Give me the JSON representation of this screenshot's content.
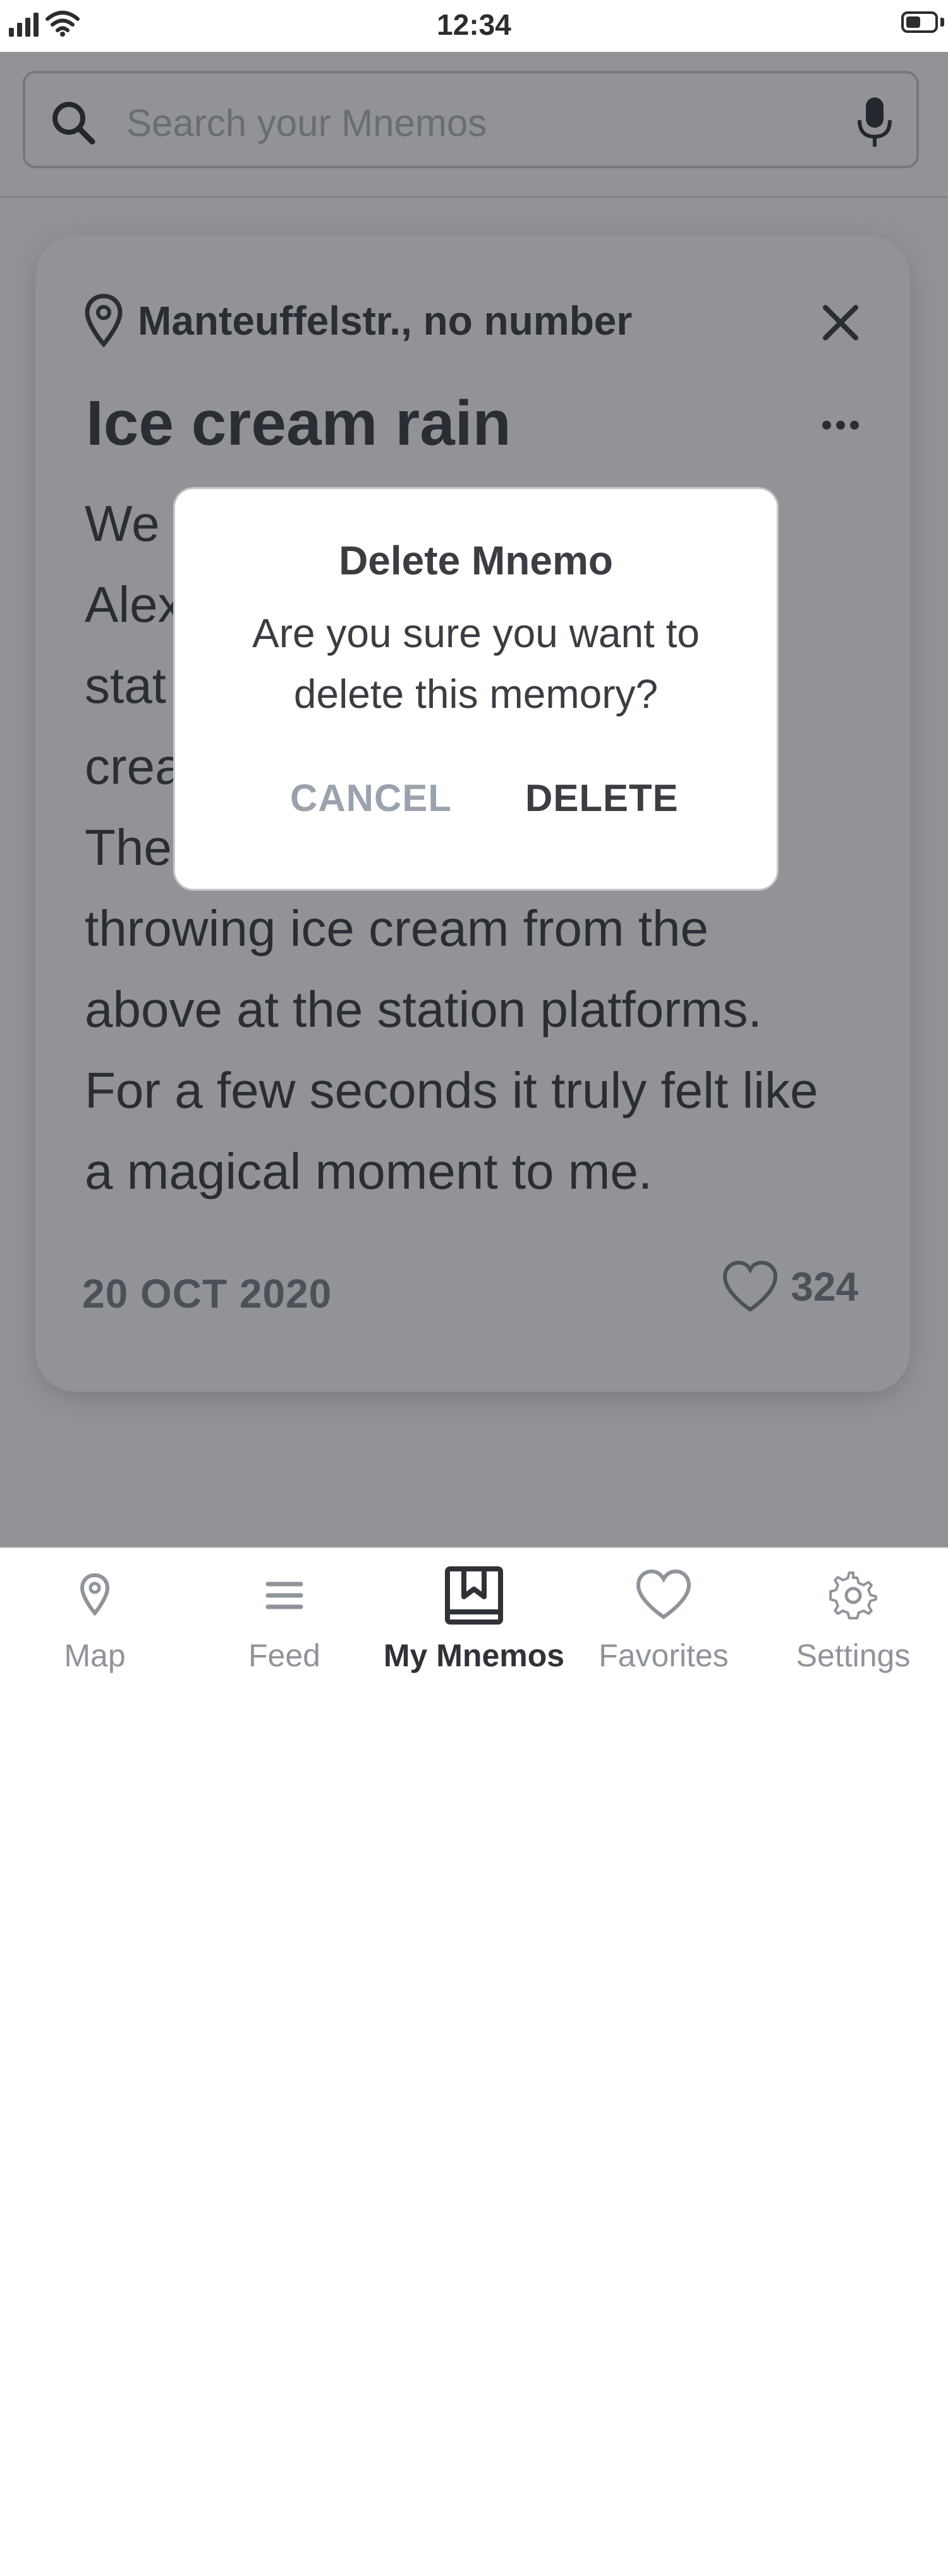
{
  "status_bar": {
    "time": "12:34"
  },
  "search": {
    "placeholder": "Search your Mnemos"
  },
  "card": {
    "location": "Manteuffelstr., no number",
    "title": "Ice cream rain",
    "body": "We\nAlex\nstat\ncrea\nThe\nthrowing ice cream from the\nabove at the station platforms.\nFor a few seconds it truly felt like\na magical moment to me.",
    "date": "20 OCT 2020",
    "likes": "324"
  },
  "dialog": {
    "title": "Delete Mnemo",
    "message": "Are you sure you want to delete this memory?",
    "cancel_label": "CANCEL",
    "delete_label": "DELETE"
  },
  "nav": {
    "items": [
      {
        "label": "Map",
        "icon": "map-pin-icon"
      },
      {
        "label": "Feed",
        "icon": "list-icon"
      },
      {
        "label": "My Mnemos",
        "icon": "bookmark-book-icon",
        "active": true
      },
      {
        "label": "Favorites",
        "icon": "heart-icon"
      },
      {
        "label": "Settings",
        "icon": "gear-icon"
      }
    ]
  },
  "colors": {
    "text_dark": "#3a3d42",
    "text_muted": "#8f949b",
    "overlay": "#191d25",
    "cancel": "#9aa3ad"
  }
}
